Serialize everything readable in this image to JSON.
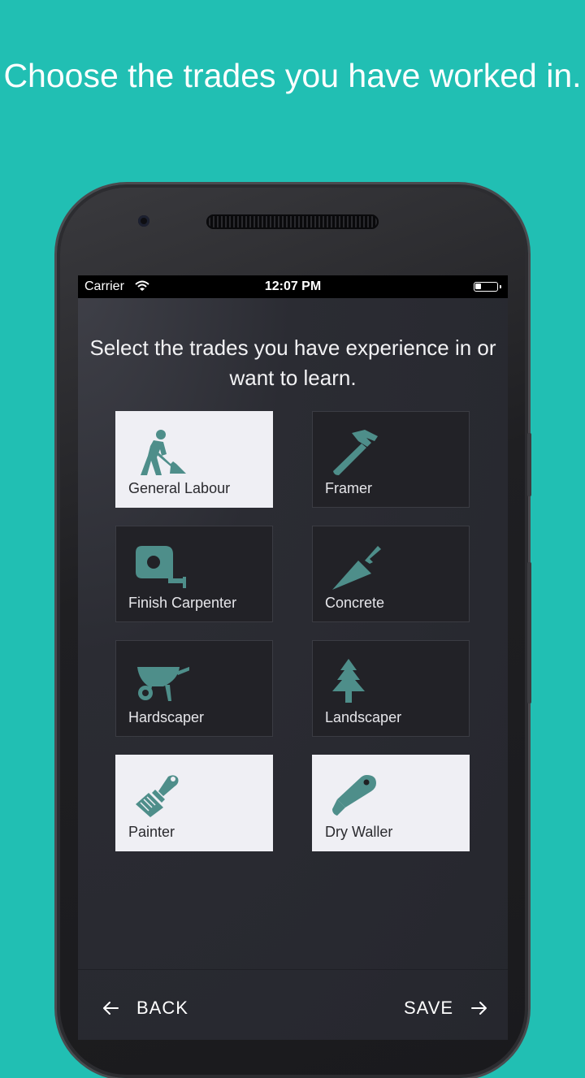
{
  "headline": "Choose the trades you have worked in.",
  "status_bar": {
    "carrier": "Carrier",
    "time": "12:07 PM"
  },
  "prompt": "Select the trades you have experience in or want to learn.",
  "accent_color": "#4e8e8a",
  "trades": [
    {
      "label": "General Labour",
      "icon": "shovel-worker-icon",
      "selected": true
    },
    {
      "label": "Framer",
      "icon": "hammer-icon",
      "selected": false
    },
    {
      "label": "Finish Carpenter",
      "icon": "tape-measure-icon",
      "selected": false
    },
    {
      "label": "Concrete",
      "icon": "trowel-icon",
      "selected": false
    },
    {
      "label": "Hardscaper",
      "icon": "wheelbarrow-icon",
      "selected": false
    },
    {
      "label": "Landscaper",
      "icon": "pine-tree-icon",
      "selected": false
    },
    {
      "label": "Painter",
      "icon": "paint-brush-icon",
      "selected": true
    },
    {
      "label": "Dry Waller",
      "icon": "utility-knife-icon",
      "selected": true
    }
  ],
  "nav": {
    "back_label": "BACK",
    "save_label": "SAVE"
  }
}
